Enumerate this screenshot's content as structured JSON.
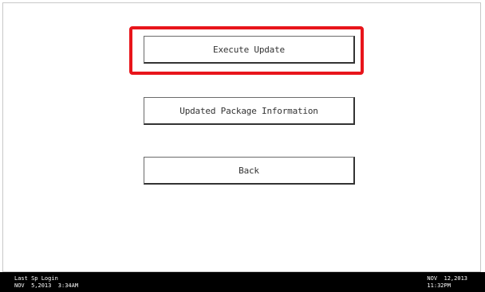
{
  "menu": {
    "execute_update_label": "Execute Update",
    "package_info_label": "Updated Package Information",
    "back_label": "Back"
  },
  "status_bar": {
    "last_login_label": "Last Sp Login",
    "last_login_datetime": "NOV  5,2013  3:34AM",
    "current_date": "NOV  12,2013",
    "current_time": "11:32PM"
  },
  "colors": {
    "highlight": "#e8151b",
    "status_bar_bg": "#000000"
  }
}
